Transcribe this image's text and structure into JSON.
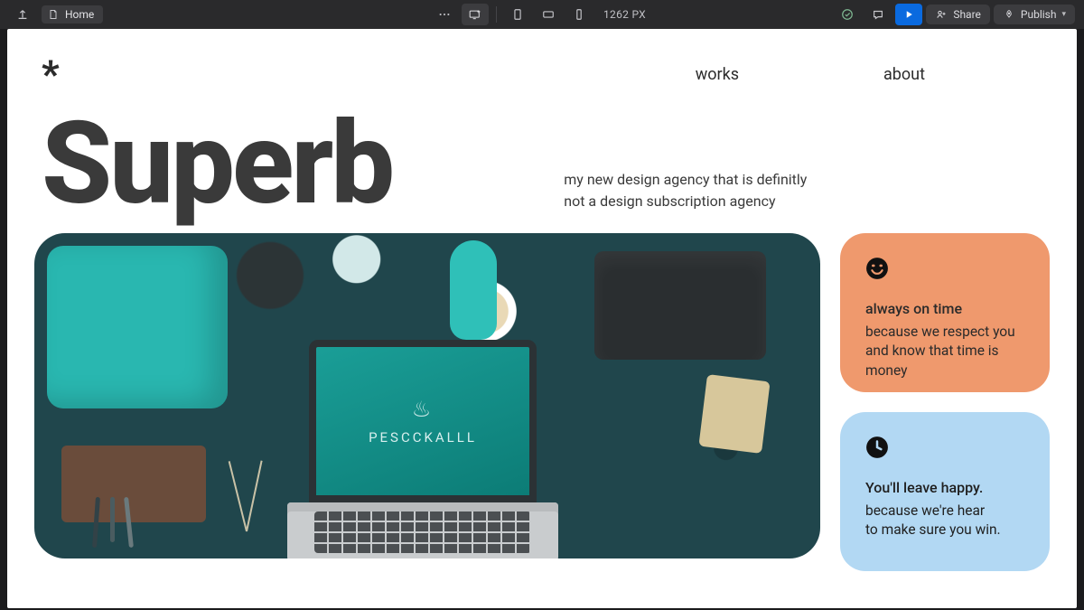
{
  "toolbar": {
    "page_tab": "Home",
    "breakpoint_label": "1262 PX",
    "share_label": "Share",
    "publish_label": "Publish"
  },
  "site": {
    "logo_glyph": "*",
    "nav": {
      "works": "works",
      "about": "about"
    },
    "hero_title": "Superb",
    "hero_tagline": "my new design agency that is definitly not a design subscription agency",
    "hero_image_logo": "PESCCKALLL"
  },
  "cards": {
    "orange": {
      "title": "always on time",
      "body": "because we respect you and know that time is money"
    },
    "blue": {
      "title": "You'll leave happy.",
      "body": "because we're hear\nto make sure you win."
    }
  }
}
